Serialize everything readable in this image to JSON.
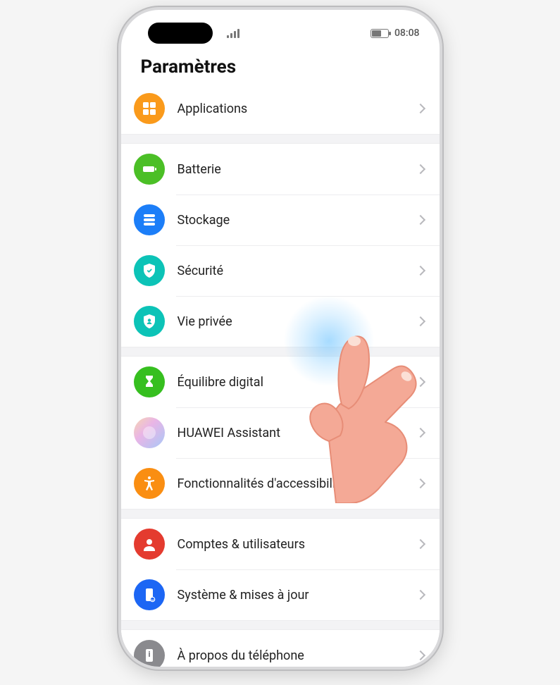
{
  "status": {
    "time": "08:08"
  },
  "page": {
    "title": "Paramètres"
  },
  "rows": {
    "applications": {
      "label": "Applications"
    },
    "battery": {
      "label": "Batterie"
    },
    "storage": {
      "label": "Stockage"
    },
    "security": {
      "label": "Sécurité"
    },
    "privacy": {
      "label": "Vie privée"
    },
    "digital": {
      "label": "Équilibre digital"
    },
    "assistant": {
      "label": "HUAWEI Assistant"
    },
    "accessibility": {
      "label": "Fonctionnalités d'accessibilité"
    },
    "accounts": {
      "label": "Comptes & utilisateurs"
    },
    "system": {
      "label": "Système & mises à jour"
    },
    "about": {
      "label": "À propos du téléphone"
    }
  }
}
